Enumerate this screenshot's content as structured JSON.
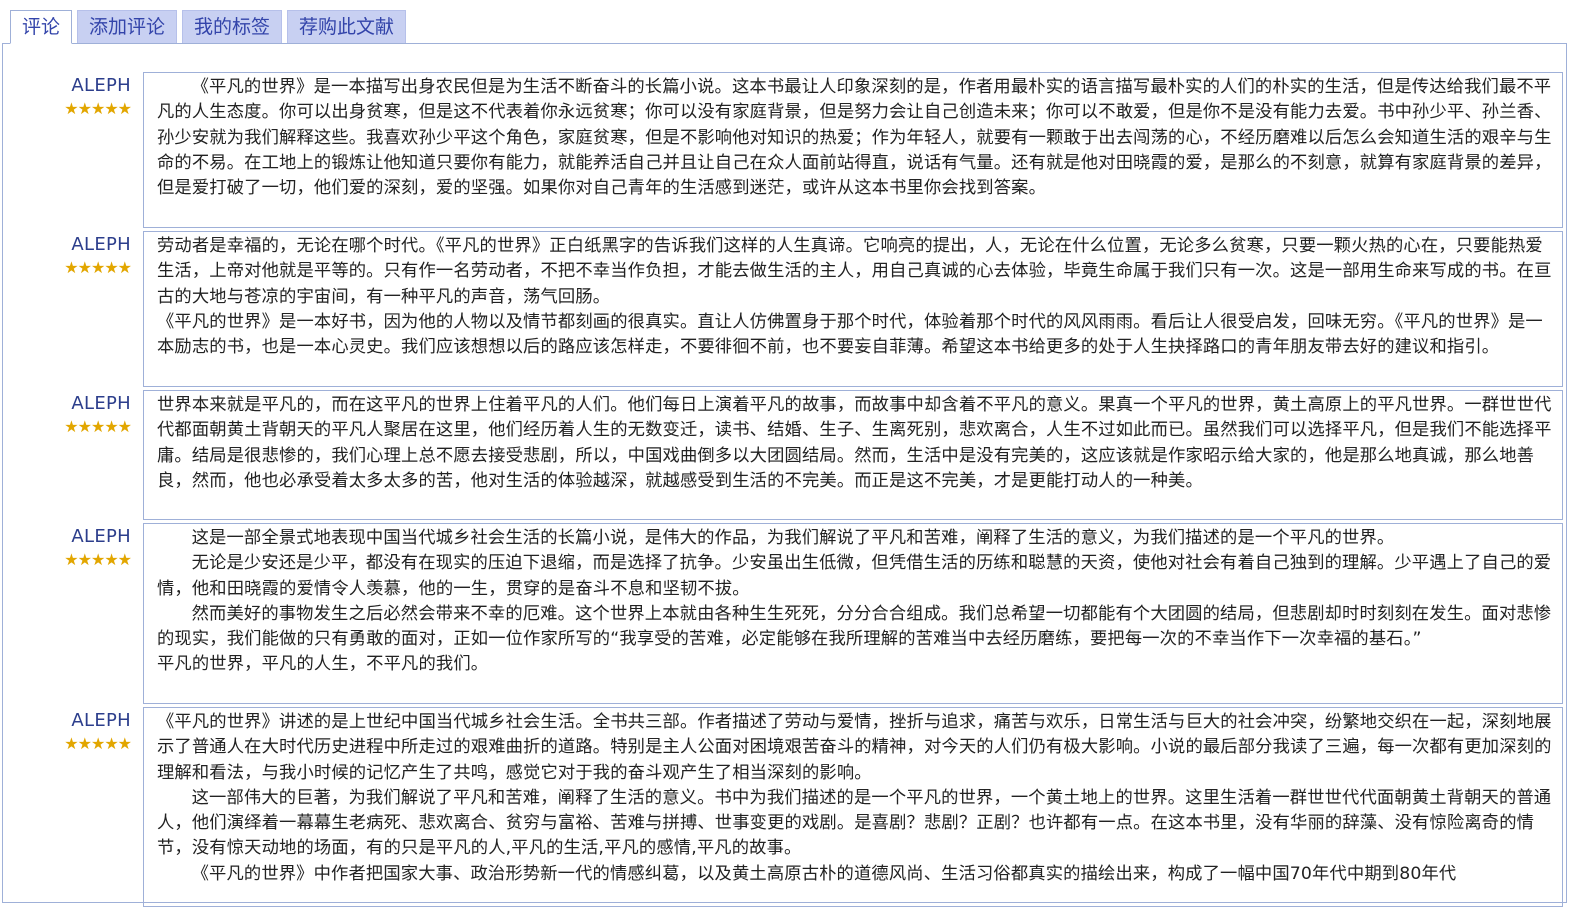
{
  "tabs": [
    {
      "label": "评论",
      "active": true
    },
    {
      "label": "添加评论",
      "active": false
    },
    {
      "label": "我的标签",
      "active": false
    },
    {
      "label": "荐购此文献",
      "active": false
    }
  ],
  "colors": {
    "accent": "#3344aa",
    "tab_bg": "#c8d0f2",
    "border": "#9fb0d8",
    "stars": "#e2a600"
  },
  "reviews": [
    {
      "user": "ALEPH",
      "stars": "★★★★★",
      "rating": 5,
      "paragraphs": [
        {
          "indent": true,
          "text": "《平凡的世界》是一本描写出身农民但是为生活不断奋斗的长篇小说。这本书最让人印象深刻的是，作者用最朴实的语言描写最朴实的人们的朴实的生活，但是传达给我们最不平凡的人生态度。你可以出身贫寒，但是这不代表着你永远贫寒；你可以没有家庭背景，但是努力会让自己创造未来；你可以不敢爱，但是你不是没有能力去爱。书中孙少平、孙兰香、孙少安就为我们解释这些。我喜欢孙少平这个角色，家庭贫寒，但是不影响他对知识的热爱；作为年轻人，就要有一颗敢于出去闯荡的心，不经历磨难以后怎么会知道生活的艰辛与生命的不易。在工地上的锻炼让他知道只要你有能力，就能养活自己并且让自己在众人面前站得直，说话有气量。还有就是他对田晓霞的爱，是那么的不刻意，就算有家庭背景的差异，但是爱打破了一切，他们爱的深刻，爱的坚强。如果你对自己青年的生活感到迷茫，或许从这本书里你会找到答案。"
        }
      ]
    },
    {
      "user": "ALEPH",
      "stars": "★★★★★",
      "rating": 5,
      "paragraphs": [
        {
          "indent": false,
          "text": "劳动者是幸福的，无论在哪个时代。《平凡的世界》正白纸黑字的告诉我们这样的人生真谛。它响亮的提出，人，无论在什么位置，无论多么贫寒，只要一颗火热的心在，只要能热爱生活，上帝对他就是平等的。只有作一名劳动者，不把不幸当作负担，才能去做生活的主人，用自己真诚的心去体验，毕竟生命属于我们只有一次。这是一部用生命来写成的书。在亘古的大地与苍凉的宇宙间，有一种平凡的声音，荡气回肠。"
        },
        {
          "indent": false,
          "text": "《平凡的世界》是一本好书，因为他的人物以及情节都刻画的很真实。直让人仿佛置身于那个时代，体验着那个时代的风风雨雨。看后让人很受启发，回味无穷。《平凡的世界》是一本励志的书，也是一本心灵史。我们应该想想以后的路应该怎样走，不要徘徊不前，也不要妄自菲薄。希望这本书给更多的处于人生抉择路口的青年朋友带去好的建议和指引。"
        }
      ]
    },
    {
      "user": "ALEPH",
      "stars": "★★★★★",
      "rating": 5,
      "paragraphs": [
        {
          "indent": false,
          "text": "世界本来就是平凡的，而在这平凡的世界上住着平凡的人们。他们每日上演着平凡的故事，而故事中却含着不平凡的意义。果真一个平凡的世界，黄土高原上的平凡世界。一群世世代代都面朝黄土背朝天的平凡人聚居在这里，他们经历着人生的无数变迁，读书、结婚、生子、生离死别，悲欢离合，人生不过如此而已。虽然我们可以选择平凡，但是我们不能选择平庸。结局是很悲惨的，我们心理上总不愿去接受悲剧，所以，中国戏曲倒多以大团圆结局。然而，生活中是没有完美的，这应该就是作家昭示给大家的，他是那么地真诚，那么地善良，然而，他也必承受着太多太多的苦，他对生活的体验越深，就越感受到生活的不完美。而正是这不完美，才是更能打动人的一种美。"
        }
      ]
    },
    {
      "user": "ALEPH",
      "stars": "★★★★★",
      "rating": 5,
      "paragraphs": [
        {
          "indent": true,
          "text": "这是一部全景式地表现中国当代城乡社会生活的长篇小说，是伟大的作品，为我们解说了平凡和苦难，阐释了生活的意义，为我们描述的是一个平凡的世界。"
        },
        {
          "indent": true,
          "text": "无论是少安还是少平，都没有在现实的压迫下退缩，而是选择了抗争。少安虽出生低微，但凭借生活的历练和聪慧的天资，使他对社会有着自己独到的理解。少平遇上了自己的爱情，他和田晓霞的爱情令人羡慕，他的一生，贯穿的是奋斗不息和坚韧不拔。"
        },
        {
          "indent": true,
          "text": "然而美好的事物发生之后必然会带来不幸的厄难。这个世界上本就由各种生生死死，分分合合组成。我们总希望一切都能有个大团圆的结局，但悲剧却时时刻刻在发生。面对悲惨的现实，我们能做的只有勇敢的面对，正如一位作家所写的“我享受的苦难，必定能够在我所理解的苦难当中去经历磨练，要把每一次的不幸当作下一次幸福的基石。”"
        },
        {
          "indent": false,
          "text": "平凡的世界，平凡的人生，不平凡的我们。"
        }
      ]
    },
    {
      "user": "ALEPH",
      "stars": "★★★★★",
      "rating": 5,
      "paragraphs": [
        {
          "indent": false,
          "text": "《平凡的世界》讲述的是上世纪中国当代城乡社会生活。全书共三部。作者描述了劳动与爱情，挫折与追求，痛苦与欢乐，日常生活与巨大的社会冲突，纷繁地交织在一起，深刻地展示了普通人在大时代历史进程中所走过的艰难曲折的道路。特别是主人公面对困境艰苦奋斗的精神，对今天的人们仍有极大影响。小说的最后部分我读了三遍，每一次都有更加深刻的理解和看法，与我小时候的记忆产生了共鸣，感觉它对于我的奋斗观产生了相当深刻的影响。"
        },
        {
          "indent": true,
          "text": "这一部伟大的巨著，为我们解说了平凡和苦难，阐释了生活的意义。书中为我们描述的是一个平凡的世界，一个黄土地上的世界。这里生活着一群世世代代面朝黄土背朝天的普通人，他们演绎着一幕幕生老病死、悲欢离合、贫穷与富裕、苦难与拼搏、世事变更的戏剧。是喜剧？悲剧？正剧？也许都有一点。在这本书里，没有华丽的辞藻、没有惊险离奇的情节，没有惊天动地的场面，有的只是平凡的人,平凡的生活,平凡的感情,平凡的故事。"
        },
        {
          "indent": true,
          "text": "《平凡的世界》中作者把国家大事、政治形势新一代的情感纠葛，以及黄土高原古朴的道德风尚、生活习俗都真实的描绘出来，构成了一幅中国70年代中期到80年代"
        }
      ]
    }
  ]
}
